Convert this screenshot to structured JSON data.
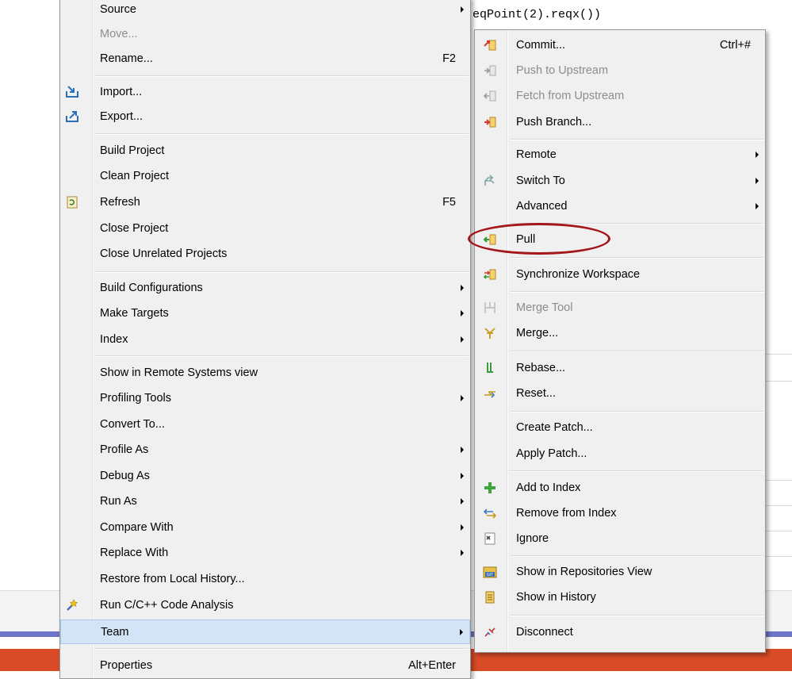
{
  "editor": {
    "code_line": "eqPoint(2).reqx())"
  },
  "main_menu": {
    "items": [
      {
        "label": "Source",
        "submenu": true
      },
      {
        "label": "Move...",
        "disabled": true
      },
      {
        "label": "Rename...",
        "accel": "F2"
      },
      {
        "label": "Import...",
        "icon": "import-icon"
      },
      {
        "label": "Export...",
        "icon": "export-icon"
      },
      {
        "label": "Build Project"
      },
      {
        "label": "Clean Project"
      },
      {
        "label": "Refresh",
        "accel": "F5",
        "icon": "refresh-icon"
      },
      {
        "label": "Close Project"
      },
      {
        "label": "Close Unrelated Projects"
      },
      {
        "label": "Build Configurations",
        "submenu": true
      },
      {
        "label": "Make Targets",
        "submenu": true
      },
      {
        "label": "Index",
        "submenu": true
      },
      {
        "label": "Show in Remote Systems view"
      },
      {
        "label": "Profiling Tools",
        "submenu": true
      },
      {
        "label": "Convert To..."
      },
      {
        "label": "Profile As",
        "submenu": true
      },
      {
        "label": "Debug As",
        "submenu": true
      },
      {
        "label": "Run As",
        "submenu": true
      },
      {
        "label": "Compare With",
        "submenu": true
      },
      {
        "label": "Replace With",
        "submenu": true
      },
      {
        "label": "Restore from Local History..."
      },
      {
        "label": "Run C/C++ Code Analysis",
        "icon": "code-analysis-icon"
      },
      {
        "label": "Team",
        "submenu": true,
        "selected": true
      },
      {
        "label": "Properties",
        "accel": "Alt+Enter"
      }
    ]
  },
  "team_menu": {
    "items": [
      {
        "label": "Commit...",
        "accel": "Ctrl+#",
        "icon": "commit-icon"
      },
      {
        "label": "Push to Upstream",
        "disabled": true,
        "icon": "push-upstream-icon"
      },
      {
        "label": "Fetch from Upstream",
        "disabled": true,
        "icon": "fetch-upstream-icon"
      },
      {
        "label": "Push Branch...",
        "icon": "push-branch-icon"
      },
      {
        "label": "Remote",
        "submenu": true
      },
      {
        "label": "Switch To",
        "submenu": true,
        "icon": "switch-branch-icon"
      },
      {
        "label": "Advanced",
        "submenu": true
      },
      {
        "label": "Pull",
        "icon": "pull-icon",
        "callout": true
      },
      {
        "label": "Synchronize Workspace",
        "icon": "synchronize-icon"
      },
      {
        "label": "Merge Tool",
        "disabled": true,
        "icon": "merge-tool-icon"
      },
      {
        "label": "Merge...",
        "icon": "merge-icon"
      },
      {
        "label": "Rebase...",
        "icon": "rebase-icon"
      },
      {
        "label": "Reset...",
        "icon": "reset-icon"
      },
      {
        "label": "Create Patch..."
      },
      {
        "label": "Apply Patch..."
      },
      {
        "label": "Add to Index",
        "icon": "add-to-index-icon"
      },
      {
        "label": "Remove from Index",
        "icon": "remove-from-index-icon"
      },
      {
        "label": "Ignore",
        "icon": "ignore-icon"
      },
      {
        "label": "Show in Repositories View",
        "icon": "git-repositories-icon"
      },
      {
        "label": "Show in History",
        "icon": "history-icon"
      },
      {
        "label": "Disconnect",
        "icon": "disconnect-icon"
      }
    ]
  },
  "colors": {
    "menu_bg": "#f0f0f0",
    "selection_bg": "#d3e4f6",
    "callout": "#a3161a",
    "bottom_bar_orange": "#d94b27",
    "bottom_bar_blue": "#6c75c6"
  }
}
